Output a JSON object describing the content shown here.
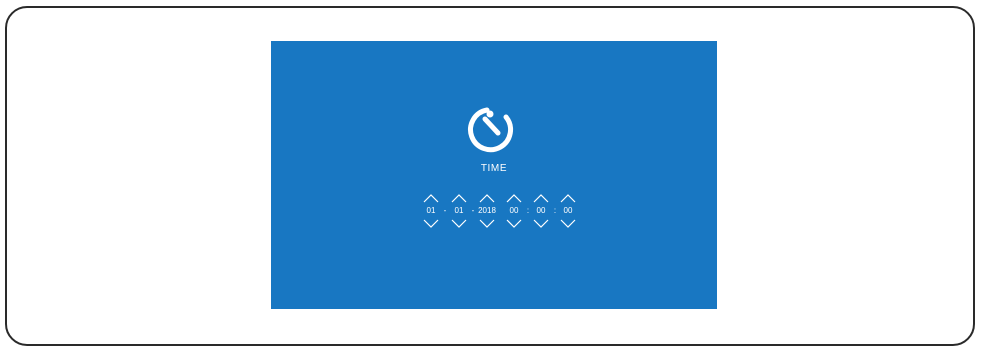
{
  "title": "TIME",
  "icon": "timer-icon",
  "colors": {
    "screen_bg": "#1877c2",
    "foreground": "#ffffff",
    "frame_border": "#2a2a2a"
  },
  "datetime": {
    "day": "01",
    "month": "01",
    "year": "2018",
    "hour": "00",
    "minute": "00",
    "second": "00",
    "date_separator": "-",
    "time_separator": ":"
  }
}
